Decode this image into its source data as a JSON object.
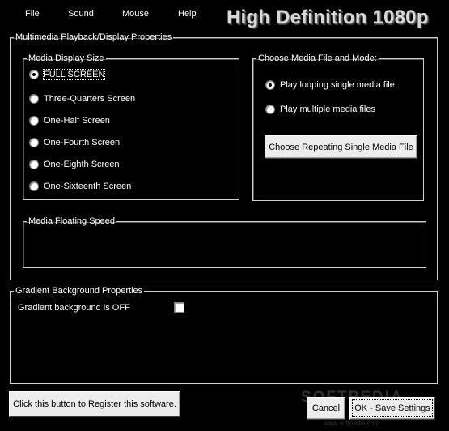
{
  "menu": {
    "file": "File",
    "sound": "Sound",
    "mouse": "Mouse",
    "help": "Help"
  },
  "app_title": "High Definition 1080p",
  "playback_group": {
    "legend": "Multimedia Playback/Display Properties"
  },
  "display_size": {
    "legend": "Media Display Size",
    "options": [
      {
        "label": "FULL SCREEN",
        "checked": true
      },
      {
        "label": "Three-Quarters Screen",
        "checked": false
      },
      {
        "label": "One-Half Screen",
        "checked": false
      },
      {
        "label": "One-Fourth Screen",
        "checked": false
      },
      {
        "label": "One-Eighth Screen",
        "checked": false
      },
      {
        "label": "One-Sixteenth Screen",
        "checked": false
      }
    ]
  },
  "media_mode": {
    "legend": "Choose Media File and Mode:",
    "options": [
      {
        "label": "Play looping single media file.",
        "checked": true
      },
      {
        "label": "Play multiple media files",
        "checked": false
      }
    ],
    "choose_button": "Choose Repeating Single Media File"
  },
  "floating_speed": {
    "legend": "Media Floating Speed"
  },
  "gradient_group": {
    "legend": "Gradient Background Properties",
    "checkbox_label": "Gradient background is OFF"
  },
  "register_button": "Click this button to Register this software.",
  "cancel_button": "Cancel",
  "ok_button": "OK - Save Settings",
  "watermark": "SOFTPEDIA",
  "watermark_sub": "www.softpedia.com"
}
